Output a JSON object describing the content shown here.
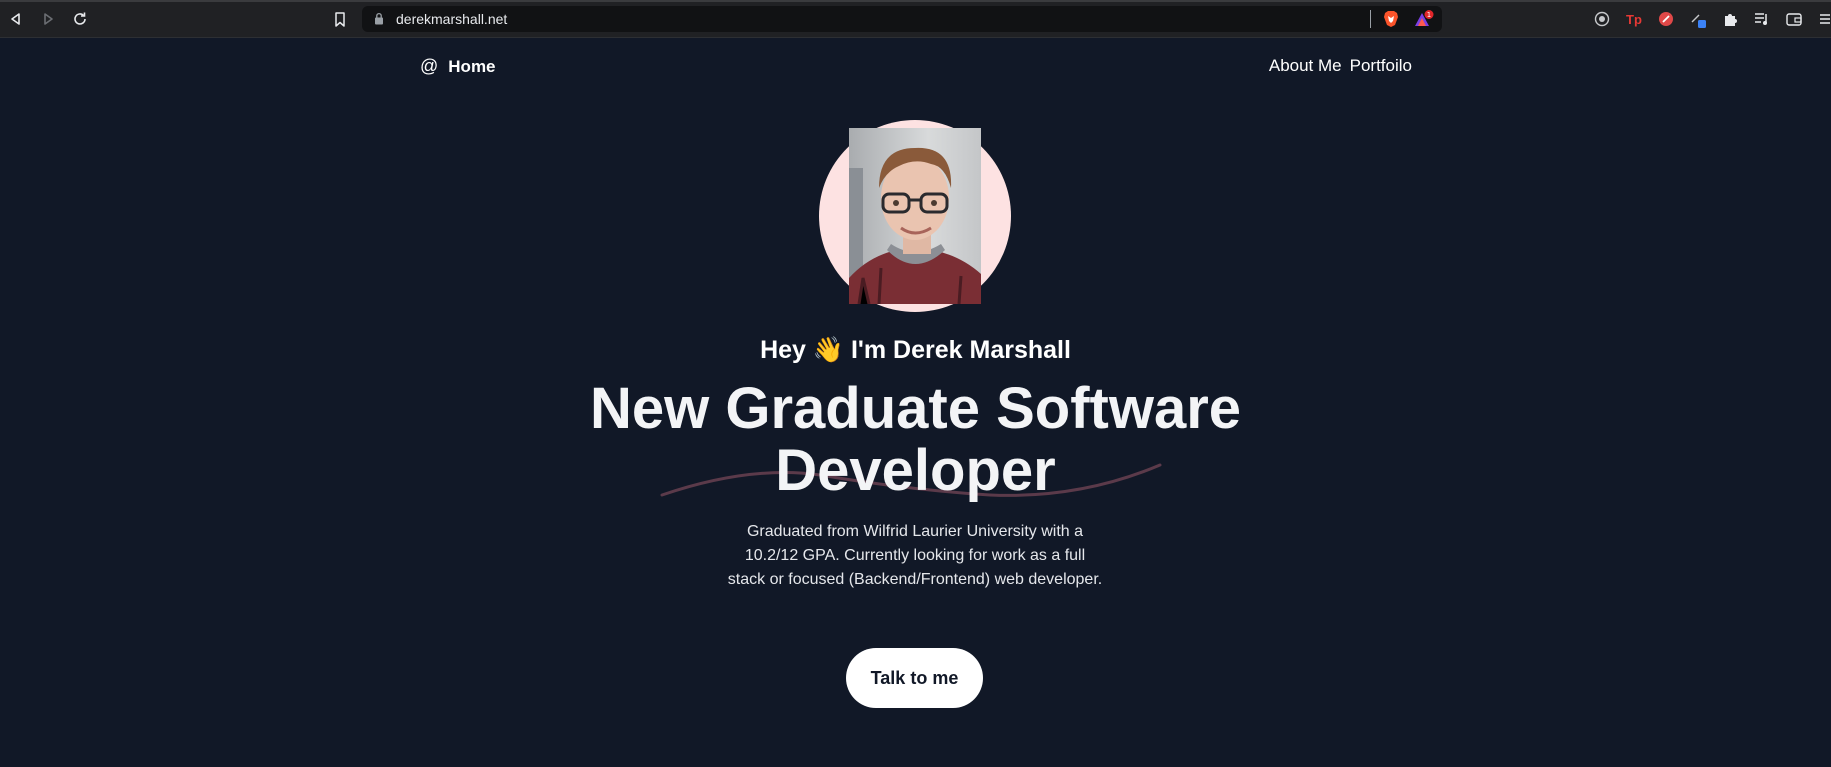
{
  "browser": {
    "url": "derekmarshall.net",
    "reward_badge": "1"
  },
  "nav": {
    "brand_icon": "@",
    "brand_label": "Home",
    "links": [
      "About Me",
      "Portfoilo"
    ]
  },
  "hero": {
    "greeting_before": "Hey",
    "greeting_after": "I'm Derek Marshall",
    "wave_emoji": "👋",
    "title_line1": "New Graduate Software",
    "title_line2": "Developer",
    "description": "Graduated from Wilfrid Laurier University with a 10.2/12 GPA. Currently looking for work as a full stack or focused (Backend/Frontend) web developer.",
    "cta_label": "Talk to me"
  },
  "colors": {
    "background": "#111827",
    "avatar_ring": "#fde2e2",
    "swoosh": "#5b3a4a"
  }
}
